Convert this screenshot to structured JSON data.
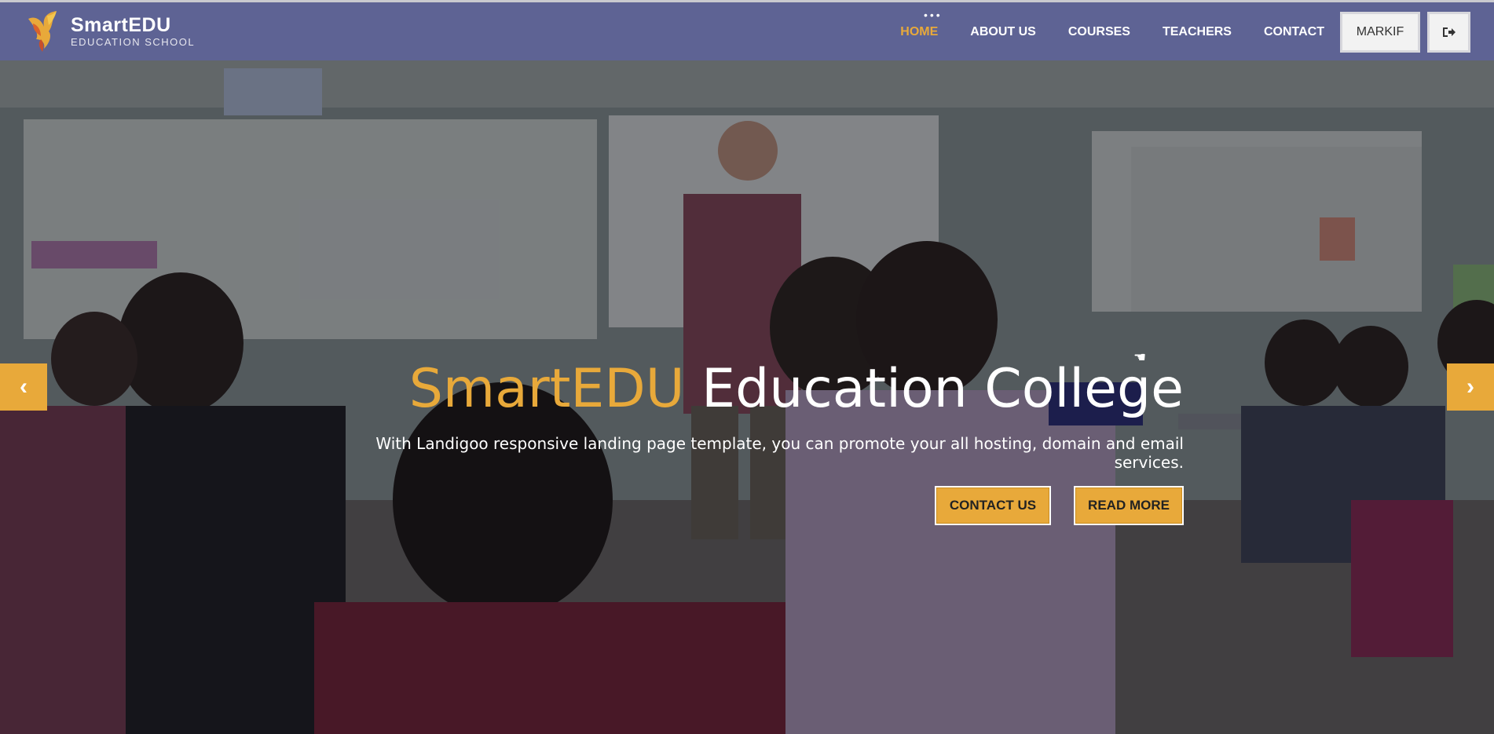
{
  "brand": {
    "name": "SmartEDU",
    "subtitle": "EDUCATION SCHOOL"
  },
  "nav": {
    "items": [
      {
        "label": "HOME",
        "active": true
      },
      {
        "label": "ABOUT US"
      },
      {
        "label": "COURSES"
      },
      {
        "label": "TEACHERS"
      },
      {
        "label": "CONTACT"
      }
    ],
    "user_button": "MARKIF",
    "logout_icon": "sign-out-icon"
  },
  "hero": {
    "title_accent": "SmartEDU",
    "title_rest": " Education College",
    "subtitle": "With Landigoo responsive landing page template, you can promote your all hosting, domain and email services.",
    "buttons": {
      "contact": "CONTACT US",
      "read_more": "READ MORE"
    }
  },
  "colors": {
    "navbar": "#5e6394",
    "accent": "#e8a93a",
    "text": "#ffffff"
  }
}
